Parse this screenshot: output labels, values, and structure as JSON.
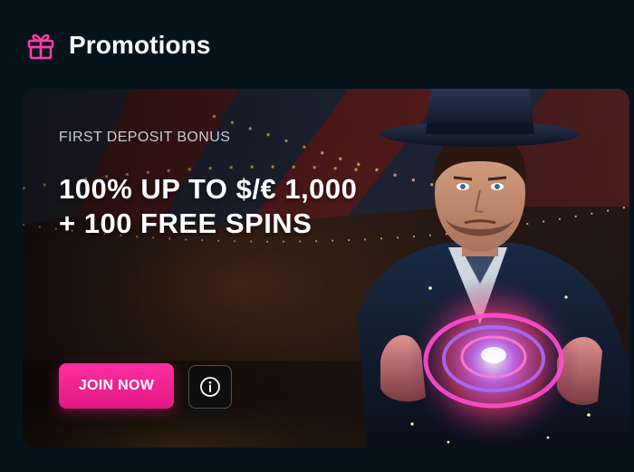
{
  "header": {
    "title": "Promotions",
    "icon": "gift-icon"
  },
  "promo": {
    "label": "FIRST DEPOSIT BONUS",
    "headline_line1": "100% UP TO $/€ 1,000",
    "headline_line2": "+ 100 FREE SPINS",
    "join_label": "JOIN NOW",
    "info_icon": "info-icon",
    "image": "magician-holding-glowing-portal"
  },
  "colors": {
    "page_bg": "#07131b",
    "accent": "#ff2fa1",
    "gift_icon": "#ff3ea5",
    "text_primary": "#ffffff",
    "text_secondary": "#c8ccd0"
  }
}
